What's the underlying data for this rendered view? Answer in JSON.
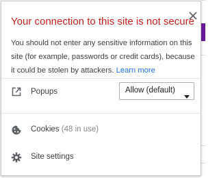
{
  "popup": {
    "title": "Your connection to this site is not secure",
    "description": "You should not enter any sensitive information on this site (for example, passwords or credit cards), because it could be stolen by attackers.",
    "learn_more": "Learn more",
    "close_icon": "close-icon"
  },
  "permissions": [
    {
      "icon": "popup-open-icon",
      "label": "Popups",
      "value": "Allow (default)"
    }
  ],
  "cookies": {
    "icon": "cookie-icon",
    "label": "Cookies",
    "count_text": "(48 in use)"
  },
  "site_settings": {
    "icon": "gear-icon",
    "label": "Site settings"
  },
  "colors": {
    "title_red": "#c5221f",
    "link_blue": "#1a73e8",
    "text": "#3c4043"
  }
}
